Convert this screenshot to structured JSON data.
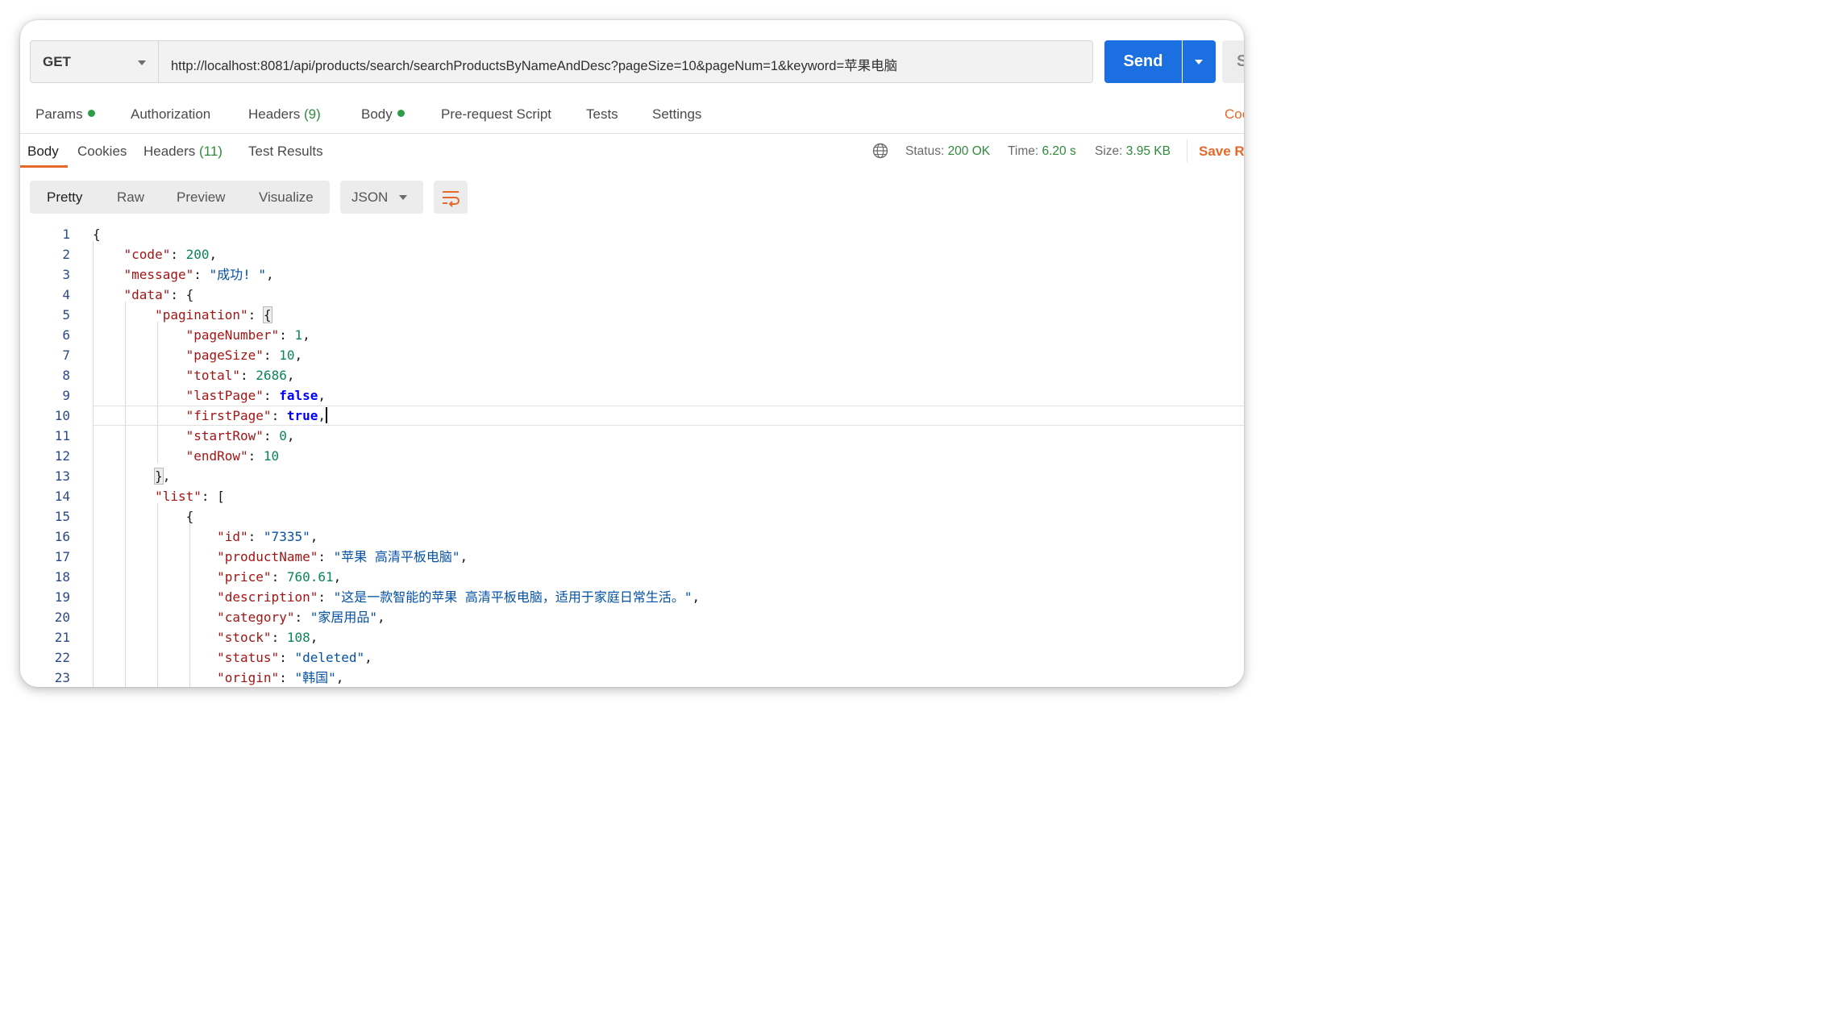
{
  "request": {
    "method": "GET",
    "url": "http://localhost:8081/api/products/search/searchProductsByNameAndDesc?pageSize=10&pageNum=1&keyword=苹果电脑",
    "send_label": "Send",
    "save_partial": "S"
  },
  "request_tabs": {
    "params": "Params",
    "authorization": "Authorization",
    "headers": "Headers",
    "headers_count": "(9)",
    "body": "Body",
    "pre_request": "Pre-request Script",
    "tests": "Tests",
    "settings": "Settings",
    "code": "Coo"
  },
  "response_tabs": {
    "body": "Body",
    "cookies": "Cookies",
    "headers": "Headers",
    "headers_count": "(11)",
    "test_results": "Test Results"
  },
  "response_status": {
    "status_label": "Status:",
    "status_value": "200 OK",
    "time_label": "Time:",
    "time_value": "6.20 s",
    "size_label": "Size:",
    "size_value": "3.95 KB",
    "save_response": "Save Re"
  },
  "view_modes": {
    "pretty": "Pretty",
    "raw": "Raw",
    "preview": "Preview",
    "visualize": "Visualize"
  },
  "format": "JSON",
  "line_numbers": [
    "1",
    "2",
    "3",
    "4",
    "5",
    "6",
    "7",
    "8",
    "9",
    "10",
    "11",
    "12",
    "13",
    "14",
    "15",
    "16",
    "17",
    "18",
    "19",
    "20",
    "21",
    "22",
    "23"
  ],
  "json": {
    "code_key": "\"code\"",
    "code_val": "200",
    "message_key": "\"message\"",
    "message_val": "\"成功! \"",
    "data_key": "\"data\"",
    "pagination_key": "\"pagination\"",
    "pageNumber_key": "\"pageNumber\"",
    "pageNumber_val": "1",
    "pageSize_key": "\"pageSize\"",
    "pageSize_val": "10",
    "total_key": "\"total\"",
    "total_val": "2686",
    "lastPage_key": "\"lastPage\"",
    "lastPage_val": "false",
    "firstPage_key": "\"firstPage\"",
    "firstPage_val": "true",
    "startRow_key": "\"startRow\"",
    "startRow_val": "0",
    "endRow_key": "\"endRow\"",
    "endRow_val": "10",
    "list_key": "\"list\"",
    "id_key": "\"id\"",
    "id_val": "\"7335\"",
    "productName_key": "\"productName\"",
    "productName_val": "\"苹果 高清平板电脑\"",
    "price_key": "\"price\"",
    "price_val": "760.61",
    "description_key": "\"description\"",
    "description_val": "\"这是一款智能的苹果 高清平板电脑，适用于家庭日常生活。\"",
    "category_key": "\"category\"",
    "category_val": "\"家居用品\"",
    "stock_key": "\"stock\"",
    "stock_val": "108",
    "status_key": "\"status\"",
    "status_val": "\"deleted\"",
    "origin_key": "\"origin\"",
    "origin_val": "\"韩国\""
  },
  "colors": {
    "accent_orange": "#e5692b",
    "send_blue": "#1c6fe0",
    "status_green": "#2e8b3a",
    "json_key": "#a31515",
    "json_string": "#0451a5",
    "json_number": "#098658",
    "json_boolean": "#0000ff"
  },
  "icons": [
    "chevron-down-icon",
    "globe-icon",
    "wrap-lines-icon"
  ]
}
